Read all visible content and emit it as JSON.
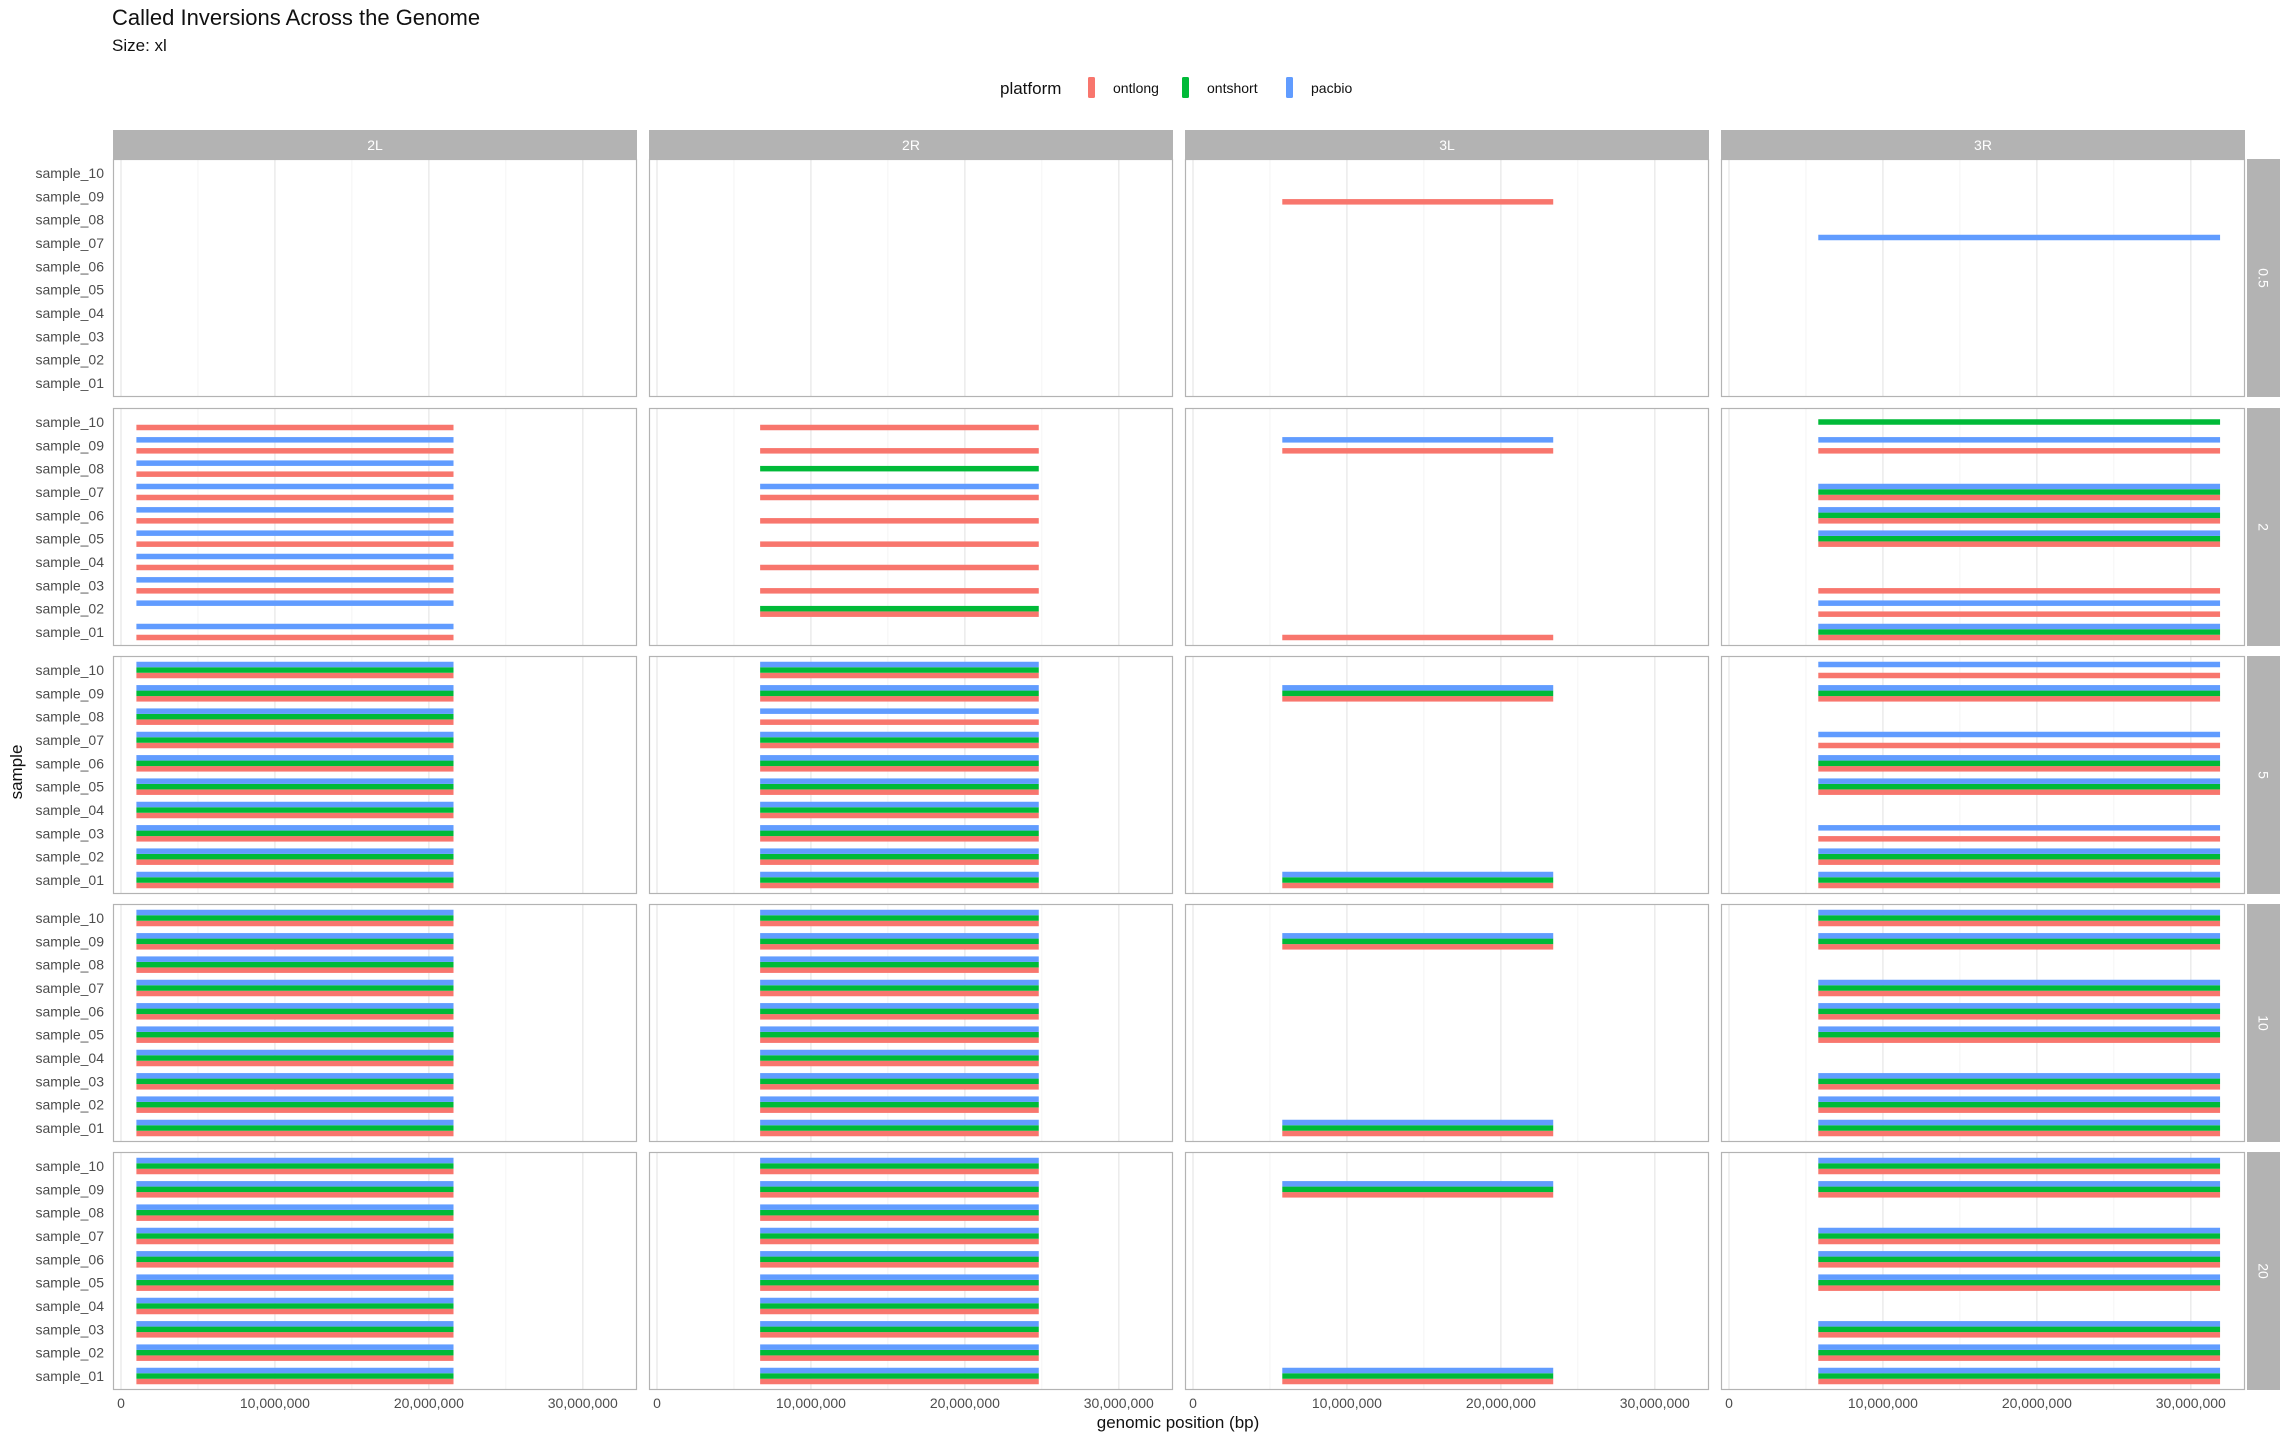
{
  "chart_data": {
    "type": "bar",
    "title": "Called Inversions Across the Genome",
    "subtitle": "Size: xl",
    "xlabel": "genomic position (bp)",
    "ylabel": "sample",
    "legend": {
      "title": "platform",
      "placement": "top",
      "entries": [
        {
          "name": "ontlong",
          "color": "#F8766D"
        },
        {
          "name": "ontshort",
          "color": "#00BA38"
        },
        {
          "name": "pacbio",
          "color": "#619CFF"
        }
      ]
    },
    "grid": true,
    "columns": [
      "2L",
      "2R",
      "3L",
      "3R"
    ],
    "rows": [
      "0.5",
      "2",
      "5",
      "10",
      "20"
    ],
    "samples": [
      "sample_01",
      "sample_02",
      "sample_03",
      "sample_04",
      "sample_05",
      "sample_06",
      "sample_07",
      "sample_08",
      "sample_09",
      "sample_10"
    ],
    "xlim": [
      0,
      33000000
    ],
    "xticks": [
      0,
      10000000,
      20000000,
      30000000
    ],
    "xtick_labels": [
      "0",
      "10,000,000",
      "20,000,000",
      "30,000,000"
    ],
    "inversion_extents": {
      "2L": [
        1000000,
        21600000
      ],
      "2R": [
        6700000,
        24800000
      ],
      "3L": [
        5800000,
        23400000
      ],
      "3R": [
        5800000,
        31900000
      ]
    },
    "calls": {
      "0.5": {
        "2L": {},
        "2R": {},
        "3L": {
          "sample_09": [
            "ontlong"
          ]
        },
        "3R": {
          "sample_07": [
            "pacbio"
          ]
        }
      },
      "2": {
        "2L": {
          "sample_10": [
            "ontlong"
          ],
          "sample_09": [
            "ontlong",
            "pacbio"
          ],
          "sample_08": [
            "ontlong",
            "pacbio"
          ],
          "sample_07": [
            "ontlong",
            "pacbio"
          ],
          "sample_06": [
            "ontlong",
            "pacbio"
          ],
          "sample_05": [
            "ontlong",
            "pacbio"
          ],
          "sample_04": [
            "ontlong",
            "pacbio"
          ],
          "sample_03": [
            "ontlong",
            "pacbio"
          ],
          "sample_02": [
            "pacbio"
          ],
          "sample_01": [
            "ontlong",
            "pacbio"
          ]
        },
        "2R": {
          "sample_10": [
            "ontlong"
          ],
          "sample_09": [
            "ontlong"
          ],
          "sample_08": [
            "ontshort"
          ],
          "sample_07": [
            "ontlong",
            "pacbio"
          ],
          "sample_06": [
            "ontlong"
          ],
          "sample_05": [
            "ontlong"
          ],
          "sample_04": [
            "ontlong"
          ],
          "sample_03": [
            "ontlong"
          ],
          "sample_02": [
            "ontlong",
            "ontshort"
          ]
        },
        "3L": {
          "sample_09": [
            "ontlong",
            "pacbio"
          ],
          "sample_01": [
            "ontlong"
          ]
        },
        "3R": {
          "sample_10": [
            "ontshort"
          ],
          "sample_09": [
            "ontlong",
            "pacbio"
          ],
          "sample_07": [
            "ontlong",
            "ontshort",
            "pacbio"
          ],
          "sample_06": [
            "ontlong",
            "ontshort",
            "pacbio"
          ],
          "sample_05": [
            "ontlong",
            "ontshort",
            "pacbio"
          ],
          "sample_03": [
            "ontlong"
          ],
          "sample_02": [
            "ontlong",
            "pacbio"
          ],
          "sample_01": [
            "ontlong",
            "ontshort",
            "pacbio"
          ]
        }
      },
      "5": {
        "2L": {
          "sample_10": [
            "ontlong",
            "ontshort",
            "pacbio"
          ],
          "sample_09": [
            "ontlong",
            "ontshort",
            "pacbio"
          ],
          "sample_08": [
            "ontlong",
            "ontshort",
            "pacbio"
          ],
          "sample_07": [
            "ontlong",
            "ontshort",
            "pacbio"
          ],
          "sample_06": [
            "ontlong",
            "ontshort",
            "pacbio"
          ],
          "sample_05": [
            "ontlong",
            "ontshort",
            "pacbio"
          ],
          "sample_04": [
            "ontlong",
            "ontshort",
            "pacbio"
          ],
          "sample_03": [
            "ontlong",
            "ontshort",
            "pacbio"
          ],
          "sample_02": [
            "ontlong",
            "ontshort",
            "pacbio"
          ],
          "sample_01": [
            "ontlong",
            "ontshort",
            "pacbio"
          ]
        },
        "2R": {
          "sample_10": [
            "ontlong",
            "ontshort",
            "pacbio"
          ],
          "sample_09": [
            "ontlong",
            "ontshort",
            "pacbio"
          ],
          "sample_08": [
            "ontlong",
            "pacbio"
          ],
          "sample_07": [
            "ontlong",
            "ontshort",
            "pacbio"
          ],
          "sample_06": [
            "ontlong",
            "ontshort",
            "pacbio"
          ],
          "sample_05": [
            "ontlong",
            "ontshort",
            "pacbio"
          ],
          "sample_04": [
            "ontlong",
            "ontshort",
            "pacbio"
          ],
          "sample_03": [
            "ontlong",
            "ontshort",
            "pacbio"
          ],
          "sample_02": [
            "ontlong",
            "ontshort",
            "pacbio"
          ],
          "sample_01": [
            "ontlong",
            "ontshort",
            "pacbio"
          ]
        },
        "3L": {
          "sample_09": [
            "ontlong",
            "ontshort",
            "pacbio"
          ],
          "sample_01": [
            "ontlong",
            "ontshort",
            "pacbio"
          ]
        },
        "3R": {
          "sample_10": [
            "ontlong",
            "pacbio"
          ],
          "sample_09": [
            "ontlong",
            "ontshort",
            "pacbio"
          ],
          "sample_07": [
            "ontlong",
            "pacbio"
          ],
          "sample_06": [
            "ontlong",
            "ontshort",
            "pacbio"
          ],
          "sample_05": [
            "ontlong",
            "ontshort",
            "pacbio"
          ],
          "sample_03": [
            "ontlong",
            "pacbio"
          ],
          "sample_02": [
            "ontlong",
            "ontshort",
            "pacbio"
          ],
          "sample_01": [
            "ontlong",
            "ontshort",
            "pacbio"
          ]
        }
      },
      "10": {
        "2L": {
          "sample_10": [
            "ontlong",
            "ontshort",
            "pacbio"
          ],
          "sample_09": [
            "ontlong",
            "ontshort",
            "pacbio"
          ],
          "sample_08": [
            "ontlong",
            "ontshort",
            "pacbio"
          ],
          "sample_07": [
            "ontlong",
            "ontshort",
            "pacbio"
          ],
          "sample_06": [
            "ontlong",
            "ontshort",
            "pacbio"
          ],
          "sample_05": [
            "ontlong",
            "ontshort",
            "pacbio"
          ],
          "sample_04": [
            "ontlong",
            "ontshort",
            "pacbio"
          ],
          "sample_03": [
            "ontlong",
            "ontshort",
            "pacbio"
          ],
          "sample_02": [
            "ontlong",
            "ontshort",
            "pacbio"
          ],
          "sample_01": [
            "ontlong",
            "ontshort",
            "pacbio"
          ]
        },
        "2R": {
          "sample_10": [
            "ontlong",
            "ontshort",
            "pacbio"
          ],
          "sample_09": [
            "ontlong",
            "ontshort",
            "pacbio"
          ],
          "sample_08": [
            "ontlong",
            "ontshort",
            "pacbio"
          ],
          "sample_07": [
            "ontlong",
            "ontshort",
            "pacbio"
          ],
          "sample_06": [
            "ontlong",
            "ontshort",
            "pacbio"
          ],
          "sample_05": [
            "ontlong",
            "ontshort",
            "pacbio"
          ],
          "sample_04": [
            "ontlong",
            "ontshort",
            "pacbio"
          ],
          "sample_03": [
            "ontlong",
            "ontshort",
            "pacbio"
          ],
          "sample_02": [
            "ontlong",
            "ontshort",
            "pacbio"
          ],
          "sample_01": [
            "ontlong",
            "ontshort",
            "pacbio"
          ]
        },
        "3L": {
          "sample_09": [
            "ontlong",
            "ontshort",
            "pacbio"
          ],
          "sample_01": [
            "ontlong",
            "ontshort",
            "pacbio"
          ]
        },
        "3R": {
          "sample_10": [
            "ontlong",
            "ontshort",
            "pacbio"
          ],
          "sample_09": [
            "ontlong",
            "ontshort",
            "pacbio"
          ],
          "sample_07": [
            "ontlong",
            "ontshort",
            "pacbio"
          ],
          "sample_06": [
            "ontlong",
            "ontshort",
            "pacbio"
          ],
          "sample_05": [
            "ontlong",
            "ontshort",
            "pacbio"
          ],
          "sample_03": [
            "ontlong",
            "ontshort",
            "pacbio"
          ],
          "sample_02": [
            "ontlong",
            "ontshort",
            "pacbio"
          ],
          "sample_01": [
            "ontlong",
            "ontshort",
            "pacbio"
          ]
        }
      },
      "20": {
        "2L": {
          "sample_10": [
            "ontlong",
            "ontshort",
            "pacbio"
          ],
          "sample_09": [
            "ontlong",
            "ontshort",
            "pacbio"
          ],
          "sample_08": [
            "ontlong",
            "ontshort",
            "pacbio"
          ],
          "sample_07": [
            "ontlong",
            "ontshort",
            "pacbio"
          ],
          "sample_06": [
            "ontlong",
            "ontshort",
            "pacbio"
          ],
          "sample_05": [
            "ontlong",
            "ontshort",
            "pacbio"
          ],
          "sample_04": [
            "ontlong",
            "ontshort",
            "pacbio"
          ],
          "sample_03": [
            "ontlong",
            "ontshort",
            "pacbio"
          ],
          "sample_02": [
            "ontlong",
            "ontshort",
            "pacbio"
          ],
          "sample_01": [
            "ontlong",
            "ontshort",
            "pacbio"
          ]
        },
        "2R": {
          "sample_10": [
            "ontlong",
            "ontshort",
            "pacbio"
          ],
          "sample_09": [
            "ontlong",
            "ontshort",
            "pacbio"
          ],
          "sample_08": [
            "ontlong",
            "ontshort",
            "pacbio"
          ],
          "sample_07": [
            "ontlong",
            "ontshort",
            "pacbio"
          ],
          "sample_06": [
            "ontlong",
            "ontshort",
            "pacbio"
          ],
          "sample_05": [
            "ontlong",
            "ontshort",
            "pacbio"
          ],
          "sample_04": [
            "ontlong",
            "ontshort",
            "pacbio"
          ],
          "sample_03": [
            "ontlong",
            "ontshort",
            "pacbio"
          ],
          "sample_02": [
            "ontlong",
            "ontshort",
            "pacbio"
          ],
          "sample_01": [
            "ontlong",
            "ontshort",
            "pacbio"
          ]
        },
        "3L": {
          "sample_09": [
            "ontlong",
            "ontshort",
            "pacbio"
          ],
          "sample_01": [
            "ontlong",
            "ontshort",
            "pacbio"
          ]
        },
        "3R": {
          "sample_10": [
            "ontlong",
            "ontshort",
            "pacbio"
          ],
          "sample_09": [
            "ontlong",
            "ontshort",
            "pacbio"
          ],
          "sample_07": [
            "ontlong",
            "ontshort",
            "pacbio"
          ],
          "sample_06": [
            "ontlong",
            "ontshort",
            "pacbio"
          ],
          "sample_05": [
            "ontlong",
            "ontshort",
            "pacbio"
          ],
          "sample_03": [
            "ontlong",
            "ontshort",
            "pacbio"
          ],
          "sample_02": [
            "ontlong",
            "ontshort",
            "pacbio"
          ],
          "sample_01": [
            "ontlong",
            "ontshort",
            "pacbio"
          ]
        }
      }
    }
  }
}
